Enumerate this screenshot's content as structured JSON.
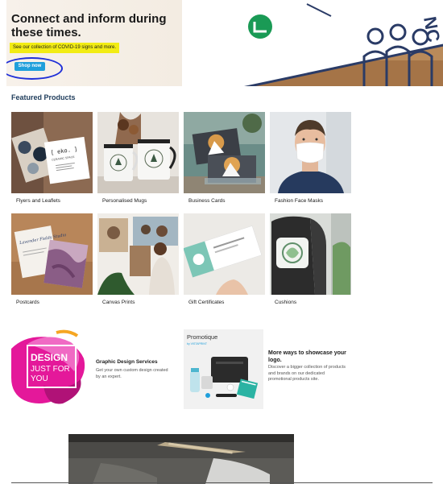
{
  "hero": {
    "title": "Connect and inform during these times.",
    "banner_text": "See our collection of COVID-19 signs and more.",
    "button_label": "Shop now"
  },
  "featured": {
    "heading": "Featured Products",
    "products": [
      {
        "label": "Flyers and Leaflets"
      },
      {
        "label": "Personalised Mugs"
      },
      {
        "label": "Business Cards"
      },
      {
        "label": "Fashion Face Masks"
      },
      {
        "label": "Postcards"
      },
      {
        "label": "Canvas Prints"
      },
      {
        "label": "Gift Certificates"
      },
      {
        "label": "Cushions"
      }
    ]
  },
  "design": {
    "image_text_1": "DESIGN",
    "image_text_2": "JUST FOR",
    "image_text_3": "YOU",
    "title": "Graphic Design Services",
    "text": "Get your own custom design created by an expert."
  },
  "promo": {
    "logo": "Promotique",
    "logo_sub": "by VISTAPRINT",
    "title": "More ways to showcase your logo.",
    "text": "Discover a bigger collection of products and brands on our dedicated promotional products site."
  },
  "images": {
    "flyer_card_text": "[ eko. ]",
    "flyer_card_sub": "CERAMIC SPACE",
    "postcard_text": "Lavender Fields Studio"
  },
  "colors": {
    "accent_blue": "#1f9fdb",
    "highlight_yellow": "#f2ec14",
    "heading_navy": "#1d3b5a"
  }
}
